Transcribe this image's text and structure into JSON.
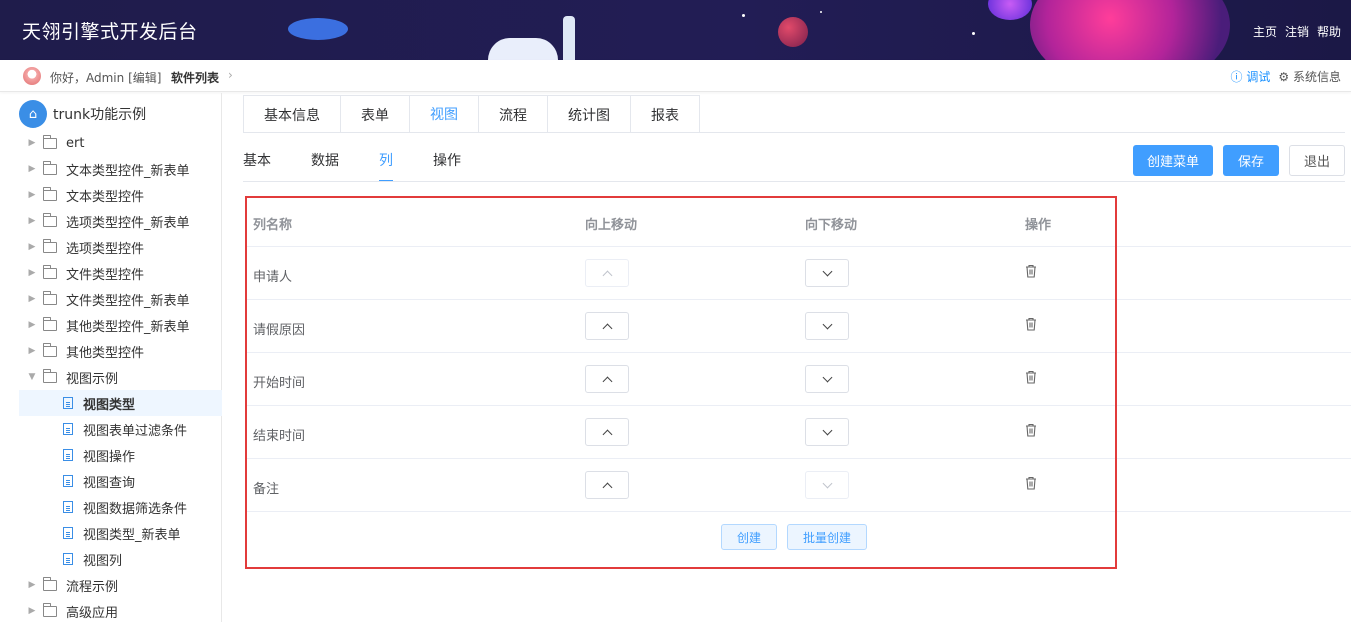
{
  "header": {
    "title": "天翎引擎式开发后台",
    "nav": [
      "主页",
      "注销",
      "帮助"
    ]
  },
  "crumb": {
    "greeting": "你好，Admin",
    "edit": "[编辑]",
    "page": "软件列表",
    "debug": "调试",
    "system": "系统信息"
  },
  "sidebar": {
    "root": "trunk功能示例",
    "folders_top": [
      "ert",
      "文本类型控件_新表单",
      "文本类型控件",
      "选项类型控件_新表单",
      "选项类型控件",
      "文件类型控件",
      "文件类型控件_新表单",
      "其他类型控件_新表单",
      "其他类型控件"
    ],
    "open_folder": "视图示例",
    "leaves": [
      "视图类型",
      "视图表单过滤条件",
      "视图操作",
      "视图查询",
      "视图数据筛选条件",
      "视图类型_新表单",
      "视图列"
    ],
    "folders_bottom": [
      "流程示例",
      "高级应用"
    ]
  },
  "tabs": [
    "基本信息",
    "表单",
    "视图",
    "流程",
    "统计图",
    "报表"
  ],
  "subtabs": [
    "基本",
    "数据",
    "列",
    "操作"
  ],
  "buttons": {
    "create_menu": "创建菜单",
    "save": "保存",
    "exit": "退出"
  },
  "table": {
    "headers": [
      "列名称",
      "向上移动",
      "向下移动",
      "操作"
    ],
    "rows": [
      "申请人",
      "请假原因",
      "开始时间",
      "结束时间",
      "备注"
    ]
  },
  "footer": {
    "create": "创建",
    "batch_create": "批量创建"
  }
}
